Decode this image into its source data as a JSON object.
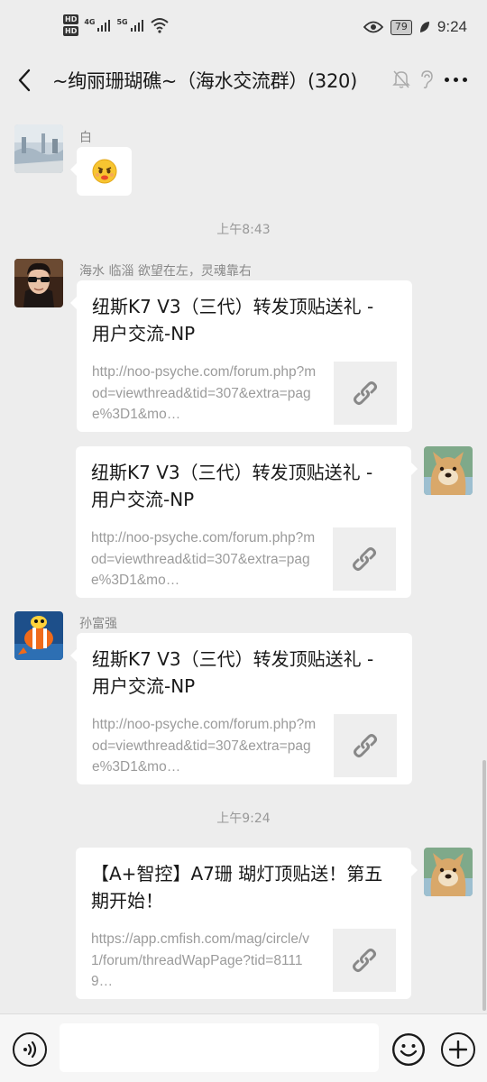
{
  "status_bar": {
    "hd1": "HD",
    "hd2": "HD",
    "net1": "4G",
    "net2": "5G",
    "battery": "79",
    "time": "9:24"
  },
  "header": {
    "title": "~绚丽珊瑚礁~（海水交流群）(320)"
  },
  "messages": {
    "m1": {
      "sender": "白"
    },
    "t1": "上午8:43",
    "m2": {
      "sender": "海水 临淄 欲望在左，灵魂靠右",
      "title": "纽斯K7 V3（三代）转发顶贴送礼 - 用户交流-NP",
      "desc": "http://noo-psyche.com/forum.php?mod=viewthread&tid=307&extra=page%3D1&mo…"
    },
    "m3": {
      "title": "纽斯K7 V3（三代）转发顶贴送礼 - 用户交流-NP",
      "desc": "http://noo-psyche.com/forum.php?mod=viewthread&tid=307&extra=page%3D1&mo…"
    },
    "m4": {
      "sender": "孙富强",
      "title": "纽斯K7 V3（三代）转发顶贴送礼 - 用户交流-NP",
      "desc": "http://noo-psyche.com/forum.php?mod=viewthread&tid=307&extra=page%3D1&mo…"
    },
    "t2": "上午9:24",
    "m5": {
      "title": "【A+智控】A7珊 瑚灯顶贴送！第五期开始！",
      "desc": "https://app.cmfish.com/mag/circle/v1/forum/threadWapPage?tid=81119…"
    }
  },
  "input": {
    "placeholder": ""
  },
  "icons": {
    "back": "back-arrow-icon",
    "mute": "mute-bell-icon",
    "ear": "ear-icon",
    "more": "more-icon",
    "link": "link-icon",
    "voice": "voice-icon",
    "emoji": "emoji-icon",
    "plus": "plus-icon"
  }
}
